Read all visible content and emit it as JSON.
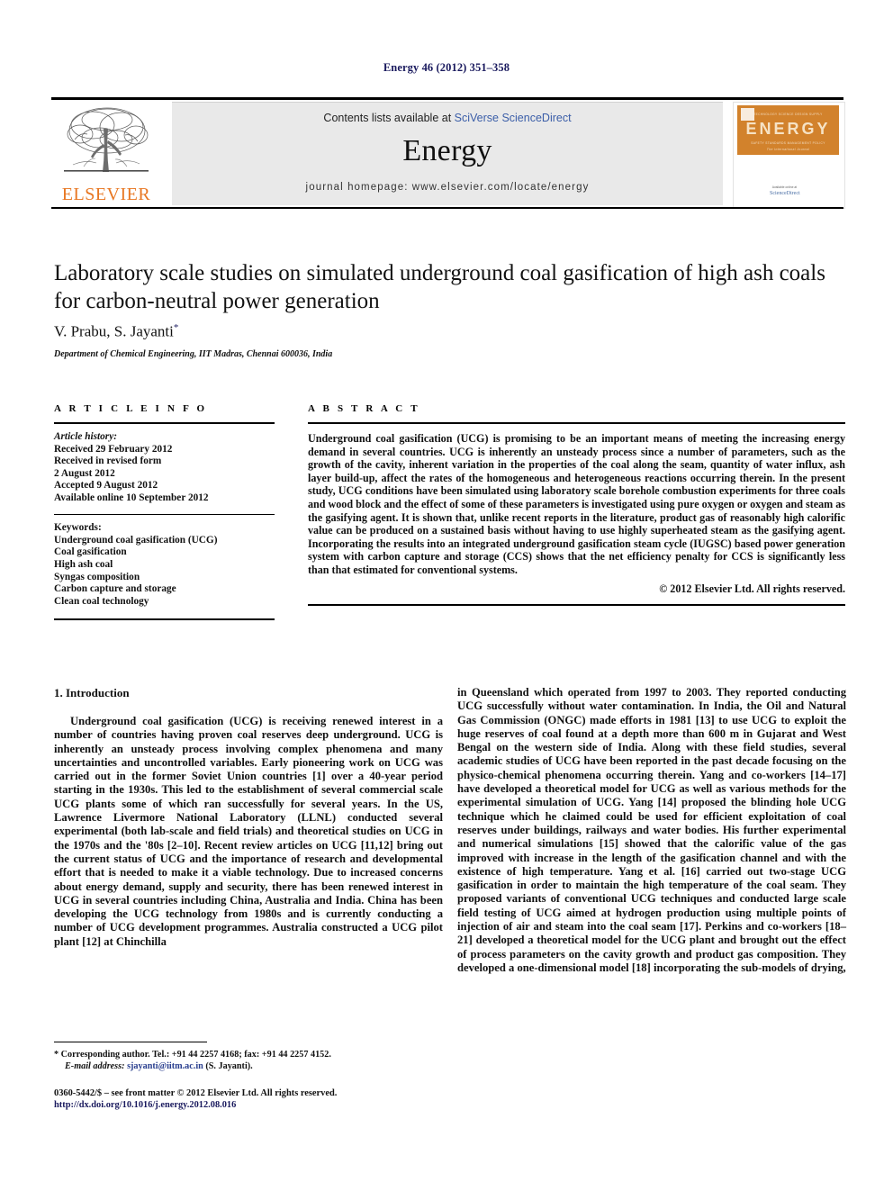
{
  "running_head": "Energy 46 (2012) 351–358",
  "masthead": {
    "publisher": "ELSEVIER",
    "contents_prefix": "Contents lists available at ",
    "contents_link": "SciVerse ScienceDirect",
    "journal_name": "Energy",
    "homepage": "journal homepage: www.elsevier.com/locate/energy",
    "cover": {
      "title": "ENERGY",
      "top_row": "TECHNOLOGY        SCIENCE        DESIGN        SUPPLY",
      "bottom_row": "SAFETY        STANDARDS        MANAGEMENT        POLICY",
      "tagline": "The International Journal",
      "footer": "Available online at",
      "sd_logo": "ScienceDirect",
      "sd_url": "www.sciencedirect.com"
    }
  },
  "article": {
    "title": "Laboratory scale studies on simulated underground coal gasification of high ash coals for carbon-neutral power generation",
    "authors": "V. Prabu, S. Jayanti",
    "author_marker": "*",
    "affiliation": "Department of Chemical Engineering, IIT Madras, Chennai 600036, India"
  },
  "article_info": {
    "heading": "A R T I C L E   I N F O",
    "history_label": "Article history:",
    "history": [
      "Received 29 February 2012",
      "Received in revised form",
      "2 August 2012",
      "Accepted 9 August 2012",
      "Available online 10 September 2012"
    ],
    "keywords_label": "Keywords:",
    "keywords": [
      "Underground coal gasification (UCG)",
      "Coal gasification",
      "High ash coal",
      "Syngas composition",
      "Carbon capture and storage",
      "Clean coal technology"
    ]
  },
  "abstract": {
    "heading": "A B S T R A C T",
    "text": "Underground coal gasification (UCG) is promising to be an important means of meeting the increasing energy demand in several countries. UCG is inherently an unsteady process since a number of parameters, such as the growth of the cavity, inherent variation in the properties of the coal along the seam, quantity of water influx, ash layer build-up, affect the rates of the homogeneous and heterogeneous reactions occurring therein. In the present study, UCG conditions have been simulated using laboratory scale borehole combustion experiments for three coals and wood block and the effect of some of these parameters is investigated using pure oxygen or oxygen and steam as the gasifying agent. It is shown that, unlike recent reports in the literature, product gas of reasonably high calorific value can be produced on a sustained basis without having to use highly superheated steam as the gasifying agent. Incorporating the results into an integrated underground gasification steam cycle (IUGSC) based power generation system with carbon capture and storage (CCS) shows that the net efficiency penalty for CCS is significantly less than that estimated for conventional systems.",
    "copyright": "© 2012 Elsevier Ltd. All rights reserved."
  },
  "body": {
    "section_title": "1. Introduction",
    "left_paragraphs": [
      "Underground coal gasification (UCG) is receiving renewed interest in a number of countries having proven coal reserves deep underground. UCG is inherently an unsteady process involving complex phenomena and many uncertainties and uncontrolled variables. Early pioneering work on UCG was carried out in the former Soviet Union countries [1] over a 40-year period starting in the 1930s. This led to the establishment of several commercial scale UCG plants some of which ran successfully for several years. In the US, Lawrence Livermore National Laboratory (LLNL) conducted several experimental (both lab-scale and field trials) and theoretical studies on UCG in the 1970s and the '80s [2–10]. Recent review articles on UCG [11,12] bring out the current status of UCG and the importance of research and developmental effort that is needed to make it a viable technology. Due to increased concerns about energy demand, supply and security, there has been renewed interest in UCG in several countries including China, Australia and India. China has been developing the UCG technology from 1980s and is currently conducting a number of UCG development programmes. Australia constructed a UCG pilot plant [12] at Chinchilla"
    ],
    "right_paragraphs": [
      "in Queensland which operated from 1997 to 2003. They reported conducting UCG successfully without water contamination. In India, the Oil and Natural Gas Commission (ONGC) made efforts in 1981 [13] to use UCG to exploit the huge reserves of coal found at a depth more than 600 m in Gujarat and West Bengal on the western side of India. Along with these field studies, several academic studies of UCG have been reported in the past decade focusing on the physico-chemical phenomena occurring therein. Yang and co-workers [14–17] have developed a theoretical model for UCG as well as various methods for the experimental simulation of UCG. Yang [14] proposed the blinding hole UCG technique which he claimed could be used for efficient exploitation of coal reserves under buildings, railways and water bodies. His further experimental and numerical simulations [15] showed that the calorific value of the gas improved with increase in the length of the gasification channel and with the existence of high temperature. Yang et al. [16] carried out two-stage UCG gasification in order to maintain the high temperature of the coal seam. They proposed variants of conventional UCG techniques and conducted large scale field testing of UCG aimed at hydrogen production using multiple points of injection of air and steam into the coal seam [17]. Perkins and co-workers [18–21] developed a theoretical model for the UCG plant and brought out the effect of process parameters on the cavity growth and product gas composition. They developed a one-dimensional model [18] incorporating the sub-models of drying,"
    ]
  },
  "footnote": {
    "marker": "*",
    "line1": "Corresponding author. Tel.: +91 44 2257 4168; fax: +91 44 2257 4152.",
    "email_label": "E-mail address:",
    "email": "sjayanti@iitm.ac.in",
    "email_owner": "(S. Jayanti)."
  },
  "footer": {
    "issn_line": "0360-5442/$ – see front matter © 2012 Elsevier Ltd. All rights reserved.",
    "doi": "http://dx.doi.org/10.1016/j.energy.2012.08.016"
  },
  "colors": {
    "link_blue": "#2a3f8f",
    "elsevier_orange": "#E87722",
    "header_navy": "#1a1a5e",
    "band_gray": "#e9e9e9"
  }
}
